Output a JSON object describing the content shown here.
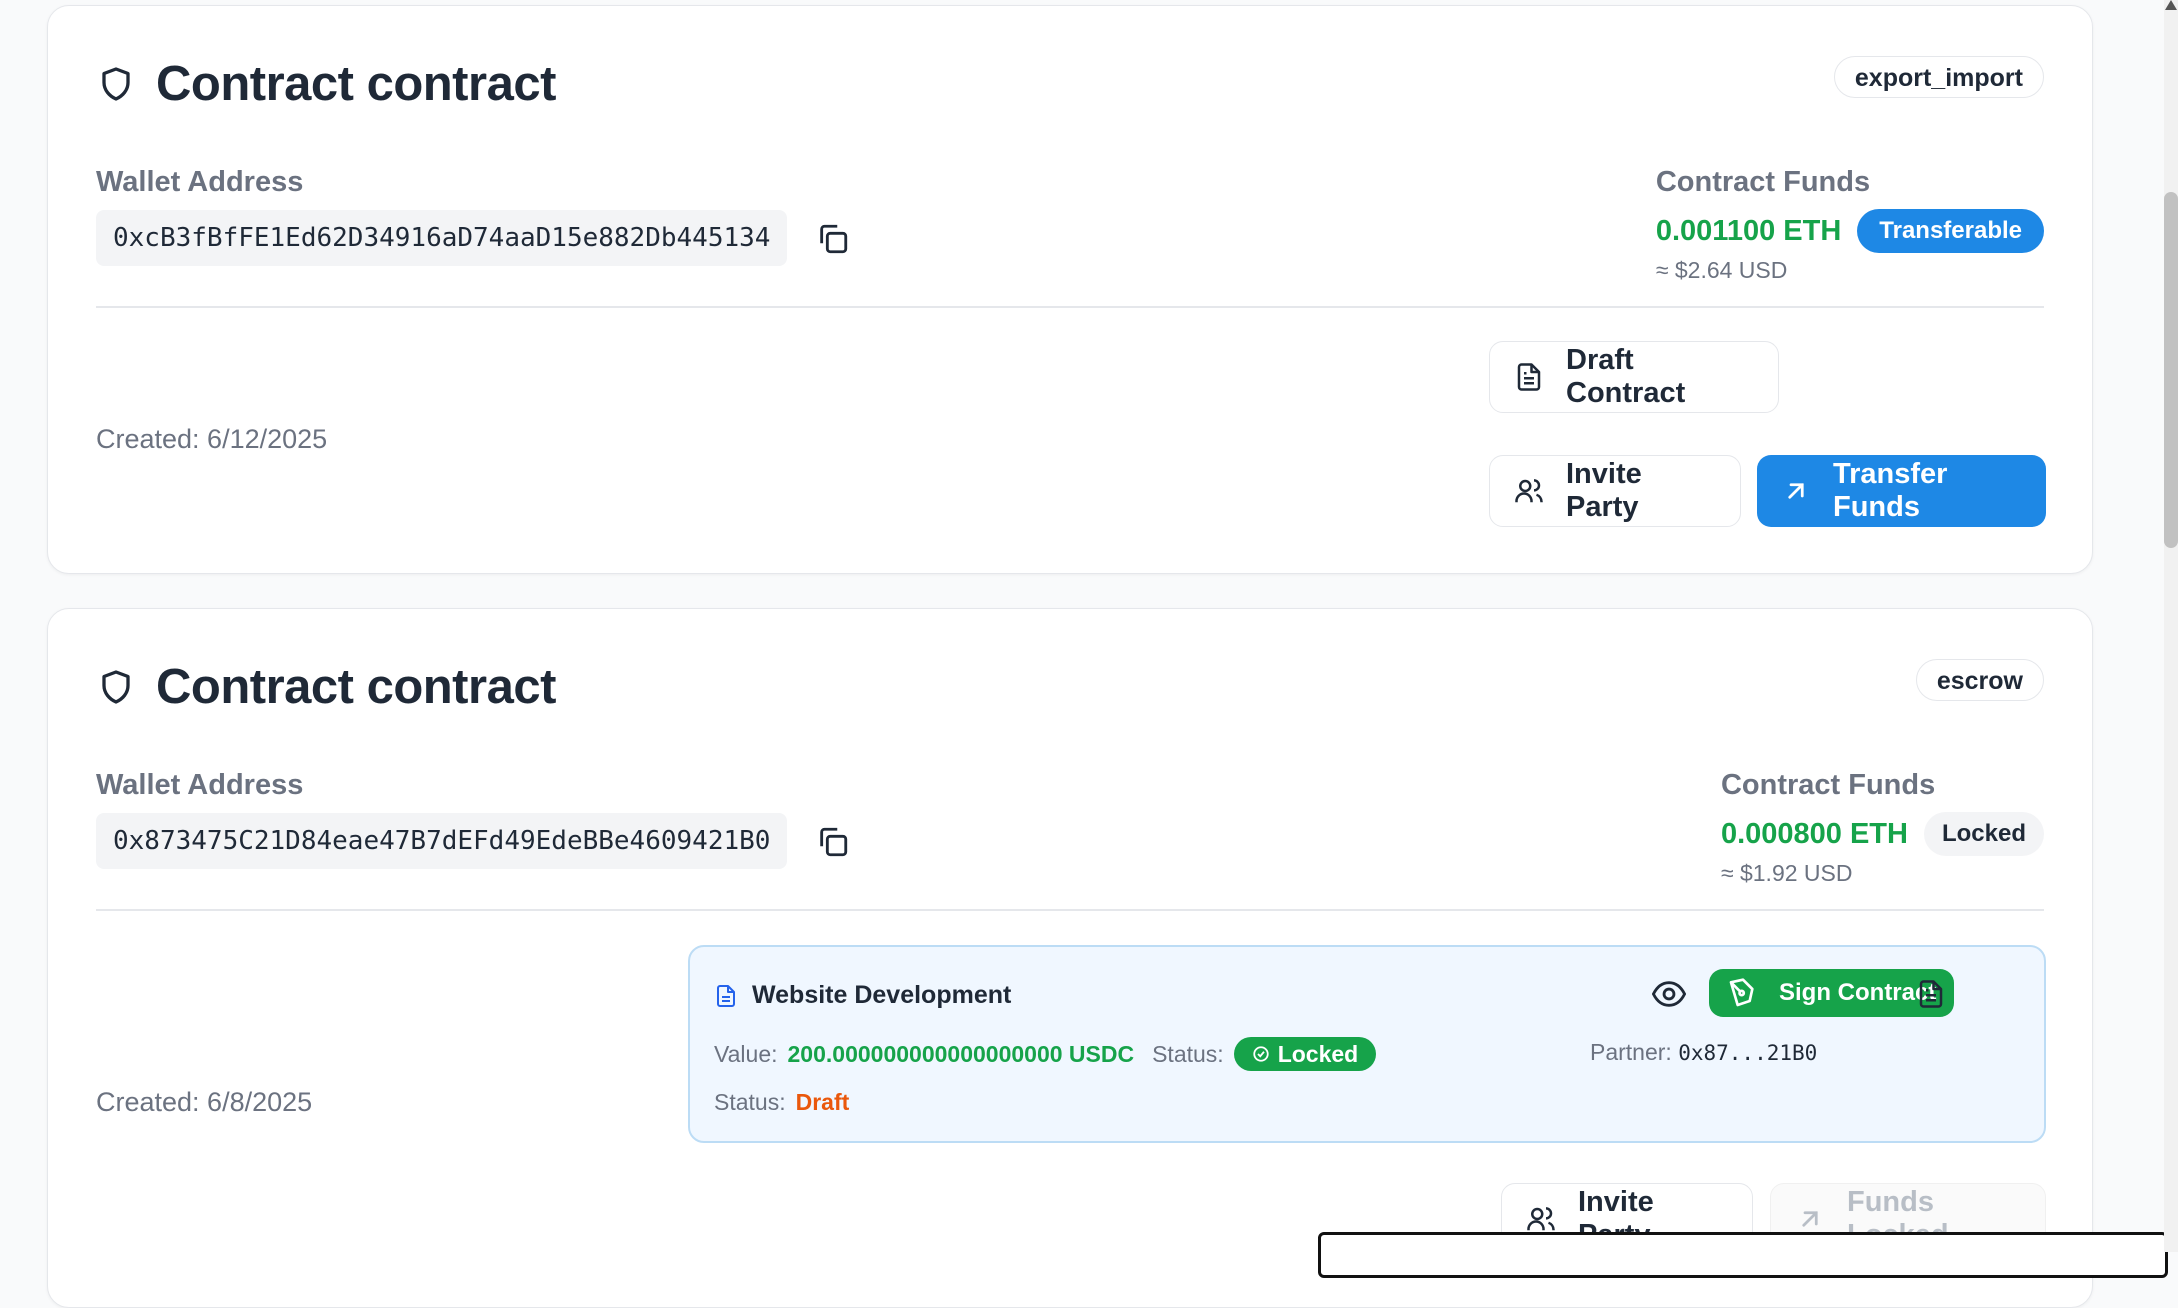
{
  "contracts": [
    {
      "title": "Contract contract",
      "type_badge": "export_import",
      "wallet_label": "Wallet Address",
      "wallet_address": "0xcB3fBfFE1Ed62D34916aD74aaD15e882Db445134",
      "funds_label": "Contract Funds",
      "funds_eth": "0.001100 ETH",
      "funds_status": "Transferable",
      "funds_usd": "≈ $2.64 USD",
      "created": "Created: 6/12/2025",
      "draft_button": "Draft Contract",
      "invite_button": "Invite Party",
      "transfer_button": "Transfer Funds"
    },
    {
      "title": "Contract contract",
      "type_badge": "escrow",
      "wallet_label": "Wallet Address",
      "wallet_address": "0x873475C21D84eae47B7dEFd49EdeBBe4609421B0",
      "funds_label": "Contract Funds",
      "funds_eth": "0.000800 ETH",
      "funds_status": "Locked",
      "funds_usd": "≈ $1.92 USD",
      "created": "Created: 6/8/2025",
      "sub_contract": {
        "title": "Website Development",
        "value_label": "Value:",
        "value": "200.000000000000000000 USDC",
        "status_label": "Status:",
        "status_pill": "Locked",
        "partner_label": "Partner:",
        "partner": "0x87...21B0",
        "status2_label": "Status:",
        "status2": "Draft",
        "sign_button": "Sign Contract"
      },
      "invite_button": "Invite Party",
      "locked_button": "Funds Locked"
    }
  ],
  "colors": {
    "accent_blue": "#1e88e5",
    "success_green": "#16a34a",
    "draft_orange": "#ea580c"
  }
}
